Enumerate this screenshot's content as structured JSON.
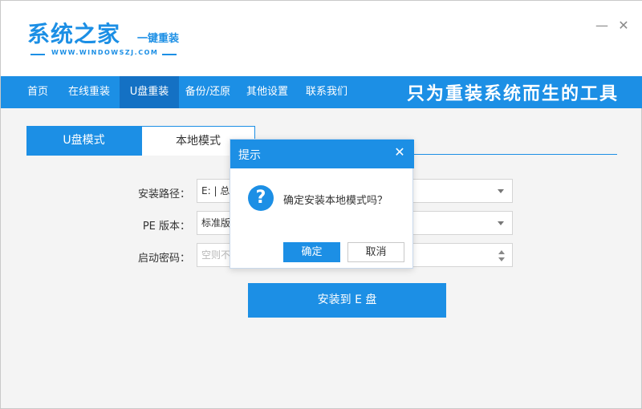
{
  "logo": {
    "main": "系统之家",
    "sub": "一键重装",
    "url": "WWW.WINDOWSZJ.COM"
  },
  "window_controls": {
    "minimize": "—",
    "close": "✕"
  },
  "nav": {
    "items": [
      {
        "label": "首页"
      },
      {
        "label": "在线重装"
      },
      {
        "label": "U盘重装"
      },
      {
        "label": "备份/还原"
      },
      {
        "label": "其他设置"
      },
      {
        "label": "联系我们"
      }
    ],
    "active": "U盘重装",
    "slogan": "只为重装系统而生的工具"
  },
  "tabs": [
    {
      "label": "U盘模式",
      "active": true
    },
    {
      "label": "本地模式",
      "active": false
    }
  ],
  "form": {
    "install_path_label": "安装路径：",
    "install_path_value": "E: | 总",
    "pe_version_label": "PE 版本：",
    "pe_version_value": "标准版",
    "boot_password_label": "启动密码：",
    "boot_password_placeholder": "空则不"
  },
  "install_button": "安装到 E 盘",
  "dialog": {
    "title": "提示",
    "close": "✕",
    "icon": "?",
    "message": "确定安装本地模式吗？",
    "ok": "确定",
    "cancel": "取消"
  },
  "colors": {
    "accent": "#1c8fe5",
    "nav_active": "#1471c4",
    "background": "#f4f4f4"
  }
}
